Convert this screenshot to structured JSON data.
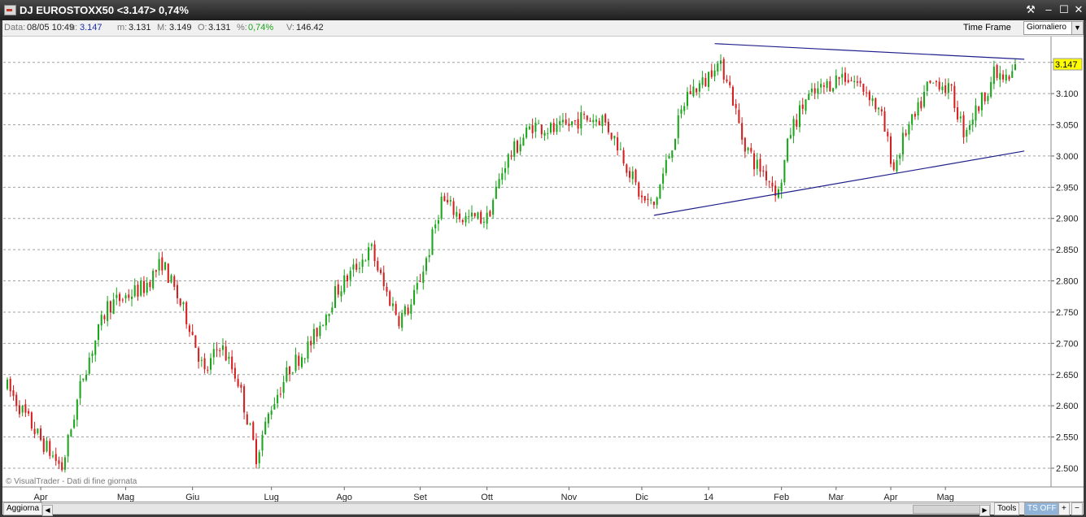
{
  "window": {
    "title": "DJ EUROSTOXX50 <3.147> 0,74%",
    "buttons": [
      "⚒",
      "–",
      "☐",
      "✕"
    ]
  },
  "infobar": {
    "data_label": "Data:",
    "data_value": "08/05 10:49",
    "u_label": "u:",
    "u_value": "3.147",
    "m_label": "m:",
    "m_value": "3.131",
    "M_label": "M:",
    "M_value": "3.149",
    "O_label": "O:",
    "O_value": "3.131",
    "pct_label": "%:",
    "pct_value": "0,74%",
    "V_label": "V:",
    "V_value": "146.42",
    "time_frame_label": "Time Frame",
    "time_frame_value": "Giornaliero"
  },
  "colors": {
    "up": "#1aa51a",
    "down": "#d31f1f",
    "trend": "#1f1f8a",
    "price_tag": "#ffff00",
    "grid": "#a0a0a0"
  },
  "chart_data": {
    "type": "candlestick",
    "instrument": "DJ EUROSTOXX50",
    "last_price": "3.147",
    "watermark": "© VisualTrader - Dati di fine giornata",
    "y_ticks": [
      "2.500",
      "2.550",
      "2.600",
      "2.650",
      "2.700",
      "2.750",
      "2.800",
      "2.850",
      "2.900",
      "2.950",
      "3.000",
      "3.050",
      "3.100",
      "3.150"
    ],
    "ylim": [
      2.47,
      3.19
    ],
    "x_ticks": [
      "Apr",
      "Mag",
      "Giu",
      "Lug",
      "Ago",
      "Set",
      "Ott",
      "Nov",
      "Dic",
      "14",
      "Feb",
      "Mar",
      "Apr",
      "Mag"
    ],
    "x_tick_index": [
      11,
      39,
      61,
      87,
      111,
      136,
      158,
      185,
      209,
      231,
      255,
      273,
      291,
      309
    ],
    "close_anchors": [
      [
        0,
        2.63
      ],
      [
        11,
        2.545
      ],
      [
        18,
        2.5
      ],
      [
        25,
        2.65
      ],
      [
        33,
        2.76
      ],
      [
        45,
        2.79
      ],
      [
        51,
        2.83
      ],
      [
        60,
        2.73
      ],
      [
        65,
        2.65
      ],
      [
        70,
        2.7
      ],
      [
        76,
        2.64
      ],
      [
        82,
        2.52
      ],
      [
        87,
        2.6
      ],
      [
        93,
        2.66
      ],
      [
        100,
        2.7
      ],
      [
        108,
        2.78
      ],
      [
        116,
        2.83
      ],
      [
        120,
        2.85
      ],
      [
        124,
        2.79
      ],
      [
        129,
        2.74
      ],
      [
        133,
        2.76
      ],
      [
        139,
        2.85
      ],
      [
        143,
        2.93
      ],
      [
        150,
        2.9
      ],
      [
        158,
        2.9
      ],
      [
        164,
        2.99
      ],
      [
        173,
        3.05
      ],
      [
        181,
        3.04
      ],
      [
        189,
        3.06
      ],
      [
        196,
        3.06
      ],
      [
        201,
        3.02
      ],
      [
        209,
        2.93
      ],
      [
        213,
        2.92
      ],
      [
        219,
        3.02
      ],
      [
        224,
        3.1
      ],
      [
        230,
        3.12
      ],
      [
        233,
        3.15
      ],
      [
        237,
        3.13
      ],
      [
        242,
        3.03
      ],
      [
        246,
        2.99
      ],
      [
        250,
        2.97
      ],
      [
        254,
        2.94
      ],
      [
        258,
        3.04
      ],
      [
        263,
        3.09
      ],
      [
        269,
        3.11
      ],
      [
        275,
        3.13
      ],
      [
        279,
        3.12
      ],
      [
        284,
        3.1
      ],
      [
        288,
        3.06
      ],
      [
        292,
        2.98
      ],
      [
        296,
        3.04
      ],
      [
        299,
        3.06
      ],
      [
        303,
        3.11
      ],
      [
        307,
        3.12
      ],
      [
        311,
        3.1
      ],
      [
        315,
        3.04
      ],
      [
        320,
        3.08
      ],
      [
        325,
        3.13
      ],
      [
        330,
        3.12
      ],
      [
        332,
        3.147
      ]
    ],
    "trendlines": [
      {
        "name": "upper",
        "from": [
          233,
          3.18
        ],
        "to": [
          335,
          3.155
        ]
      },
      {
        "name": "lower",
        "from": [
          213,
          2.905
        ],
        "to": [
          335,
          3.008
        ]
      }
    ],
    "grid": true,
    "bars": 333
  },
  "statusbar": {
    "aggiorna": "Aggiorna",
    "tools": "Tools",
    "tsoff": "TS OFF",
    "plus": "+",
    "minus": "−"
  }
}
